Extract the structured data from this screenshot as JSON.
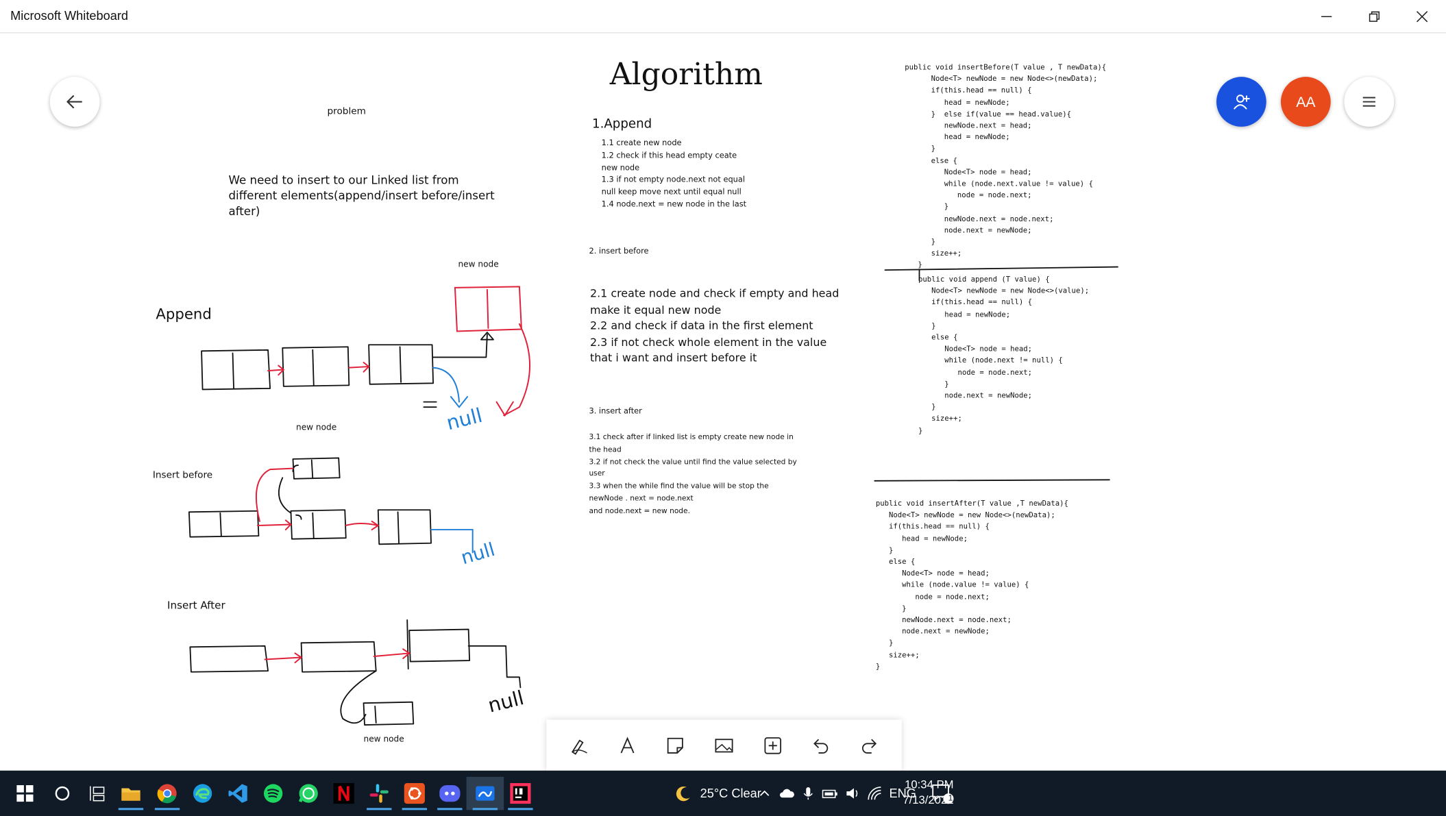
{
  "window": {
    "title": "Microsoft Whiteboard"
  },
  "board": {
    "problem_label": "problem",
    "problem_text": "We need to insert to our Linked list from\ndifferent elements(append/insert before/insert\nafter)",
    "append_label": "Append",
    "insert_before_label": "Insert before",
    "insert_after_label": "Insert After",
    "new_node_1": "new node",
    "new_node_2": "new node",
    "new_node_3": "new node",
    "algorithm_title": "Algorithm",
    "append_heading": "1.Append",
    "append_steps": "1.1 create new node\n1.2 check if this head empty ceate\nnew node\n1.3 if not empty node.next not equal\nnull keep move next until equal null\n1.4 node.next = new node in the last",
    "insert_before_heading": "2. insert before",
    "insert_before_steps": "2.1 create node and check if empty and head\nmake it equal new node\n2.2 and check if data in the first element\n2.3 if not check whole element in the value\nthat i want and insert before it",
    "insert_after_heading": "3. insert after",
    "insert_after_steps": "3.1 check after if linked list is empty create new node in\nthe head\n3.2 if not check the value until find the value selected by\nuser\n3.3 when the while find the value will be stop the\nnewNode . next = node.next\nand node.next = new node.",
    "code_insert_before": "public void insertBefore(T value , T newData){\n      Node<T> newNode = new Node<>(newData);\n      if(this.head == null) {\n         head = newNode;\n      }  else if(value == head.value){\n         newNode.next = head;\n         head = newNode;\n      }\n      else {\n         Node<T> node = head;\n         while (node.next.value != value) {\n            node = node.next;\n         }\n         newNode.next = node.next;\n         node.next = newNode;\n      }\n      size++;\n   }",
    "code_append": "public void append (T value) {\n   Node<T> newNode = new Node<>(value);\n   if(this.head == null) {\n      head = newNode;\n   }\n   else {\n      Node<T> node = head;\n      while (node.next != null) {\n         node = node.next;\n      }\n      node.next = newNode;\n   }\n   size++;\n}",
    "code_insert_after": "public void insertAfter(T value ,T newData){\n   Node<T> newNode = new Node<>(newData);\n   if(this.head == null) {\n      head = newNode;\n   }\n   else {\n      Node<T> node = head;\n      while (node.value != value) {\n         node = node.next;\n      }\n      newNode.next = node.next;\n      node.next = newNode;\n   }\n   size++;\n}",
    "null_1": "null",
    "null_2": "null",
    "null_3": "null"
  },
  "user": {
    "initials": "AA"
  },
  "colors": {
    "share_button": "#1a52e0",
    "avatar": "#e84a1b",
    "ink_red": "#e0213a",
    "ink_blue": "#1f7fd6",
    "taskbar": "#101b27"
  },
  "toolbar": {
    "tools": [
      "pen-icon",
      "text-icon",
      "sticky-note-icon",
      "image-icon",
      "add-icon",
      "undo-icon",
      "redo-icon"
    ]
  },
  "taskbar": {
    "weather": "25°C  Clear",
    "language": "ENG",
    "time": "10:34 PM",
    "date": "7/13/2021",
    "notification_count": "1",
    "apps": [
      "start",
      "search",
      "task-view",
      "file-explorer",
      "chrome",
      "edge",
      "vscode",
      "spotify",
      "whatsapp",
      "netflix",
      "slack",
      "ubuntu",
      "discord",
      "whiteboard",
      "intellij"
    ]
  }
}
